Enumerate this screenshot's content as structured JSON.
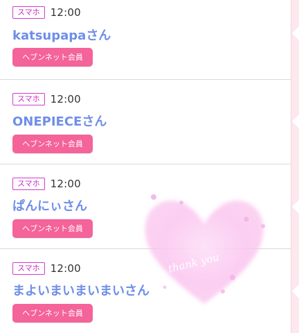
{
  "visits": [
    {
      "device": "スマホ",
      "time": "12:00",
      "name": "katsupapaさん",
      "membership": "ヘブンネット会員"
    },
    {
      "device": "スマホ",
      "time": "12:00",
      "name": "ONEPIECEさん",
      "membership": "ヘブンネット会員"
    },
    {
      "device": "スマホ",
      "time": "12:00",
      "name": "ぱんにぃさん",
      "membership": "ヘブンネット会員"
    },
    {
      "device": "スマホ",
      "time": "12:00",
      "name": "まよいまいまいまいさん",
      "membership": "ヘブンネット会員"
    }
  ],
  "sticker": {
    "text": "thank you",
    "icon": "heart-icon"
  },
  "colors": {
    "name": "#6e8ee8",
    "member_badge": "#f46399",
    "device_badge": "#c92ac9",
    "side_strip": "#fde8ee",
    "heart": "#fbc6ef"
  }
}
